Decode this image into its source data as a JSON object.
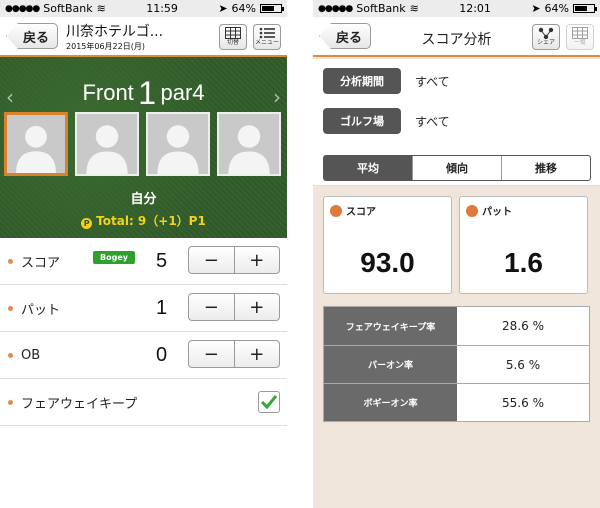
{
  "left": {
    "status": {
      "carrier": "SoftBank",
      "time": "11:59",
      "battery": "64%"
    },
    "nav": {
      "back_label": "戻る",
      "course_name": "川奈ホテルゴ...",
      "date": "2015年06月22日(月)",
      "toggle_label": "切替",
      "menu_label": "メニュー"
    },
    "hole": {
      "side": "Front",
      "number": "1",
      "par_label": "par",
      "par": "4"
    },
    "player": {
      "name": "自分",
      "total": "Total: 9（+1）P1"
    },
    "rows": [
      {
        "label": "スコア",
        "badge": "Bogey",
        "value": "5",
        "minus": "−",
        "plus": "+"
      },
      {
        "label": "パット",
        "value": "1",
        "minus": "−",
        "plus": "+"
      },
      {
        "label": "OB",
        "value": "0",
        "minus": "−",
        "plus": "+"
      },
      {
        "label": "フェアウェイキープ",
        "checked": true
      }
    ]
  },
  "right": {
    "status": {
      "carrier": "SoftBank",
      "time": "12:01",
      "battery": "64%"
    },
    "nav": {
      "back_label": "戻る",
      "title": "スコア分析",
      "share_label": "シェア",
      "list_label": "一覧"
    },
    "period": {
      "label": "分析期間",
      "value": "すべて"
    },
    "course": {
      "label": "ゴルフ場",
      "value": "すべて"
    },
    "tabs": [
      {
        "label": "平均",
        "active": true
      },
      {
        "label": "傾向",
        "active": false
      },
      {
        "label": "推移",
        "active": false
      }
    ],
    "cards": [
      {
        "label": "スコア",
        "value": "93.0"
      },
      {
        "label": "パット",
        "value": "1.6"
      }
    ],
    "stats": [
      {
        "label": "フェアウェイキープ率",
        "value": "28.6 %"
      },
      {
        "label": "パーオン率",
        "value": "5.6 %"
      },
      {
        "label": "ボギーオン率",
        "value": "55.6 %"
      }
    ]
  },
  "colors": {
    "accent": "#e08a3c",
    "green": "#2f5a28",
    "badge_green": "#2fa02d",
    "gold": "#f2d21b",
    "dark_button": "#555555"
  }
}
